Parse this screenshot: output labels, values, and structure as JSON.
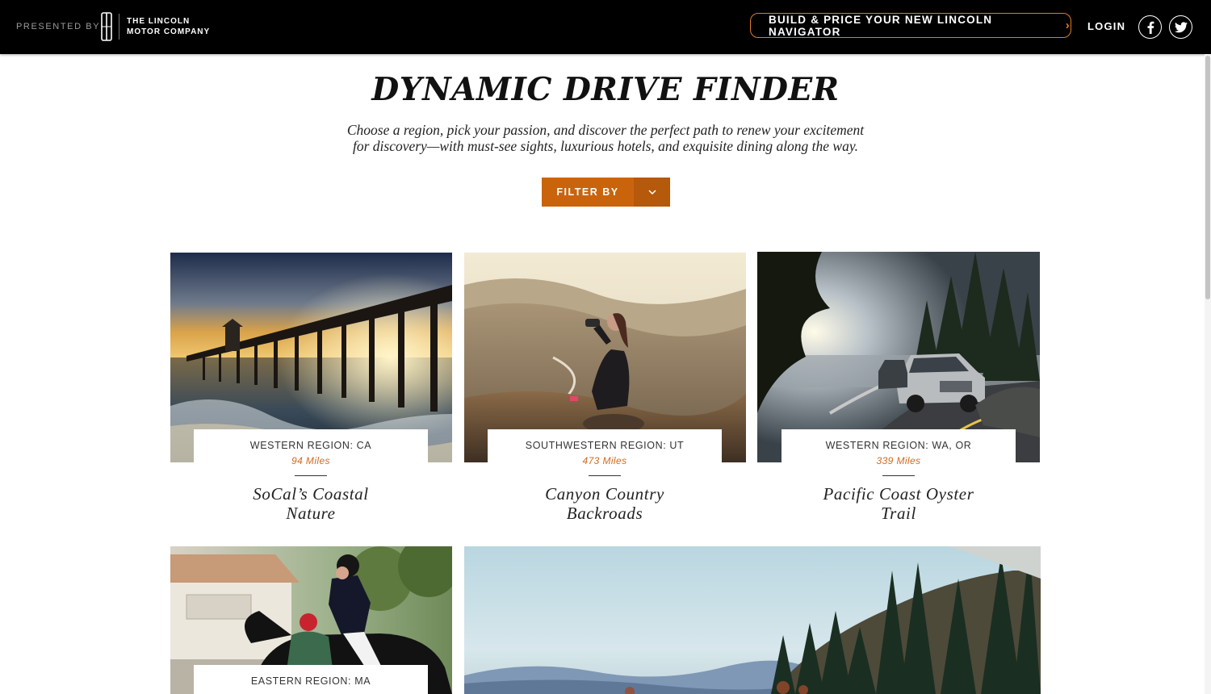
{
  "header": {
    "presented_by": "PRESENTED BY",
    "logo_line1": "THE LINCOLN",
    "logo_line2": "MOTOR COMPANY",
    "build_label": "BUILD & PRICE YOUR NEW LINCOLN NAVIGATOR",
    "build_chevron": "›",
    "login_label": "LOGIN",
    "social": [
      "facebook-icon",
      "twitter-icon"
    ]
  },
  "hero": {
    "title": "DYNAMIC DRIVE FINDER",
    "intro_line1": "Choose a region, pick your passion, and discover the perfect path to renew your excitement",
    "intro_line2": "for discovery—with must-see sights, luxurious hotels, and exquisite dining along the way.",
    "filter_label": "FILTER BY"
  },
  "colors": {
    "accent": "#c9640d",
    "accent_dark": "#b5590b",
    "outline_orange": "#e07a1f",
    "topbar": "#000000",
    "miles_text": "#d2691e"
  },
  "cards": [
    {
      "region": "WESTERN REGION: CA",
      "miles": "94 Miles",
      "title_line1": "SoCal’s Coastal",
      "title_line2": "Nature",
      "image": "pier-sunset-photo"
    },
    {
      "region": "SOUTHWESTERN REGION: UT",
      "miles": "473 Miles",
      "title_line1": "Canyon Country",
      "title_line2": "Backroads",
      "image": "hiker-binoculars-photo"
    },
    {
      "region": "WESTERN REGION: WA, OR",
      "miles": "339 Miles",
      "title_line1": "Pacific Coast Oyster",
      "title_line2": "Trail",
      "image": "navigator-coast-road-photo"
    },
    {
      "region": "EASTERN REGION: MA",
      "image": "equestrian-rider-photo"
    },
    {
      "image": "forest-mountain-vista-photo"
    }
  ]
}
